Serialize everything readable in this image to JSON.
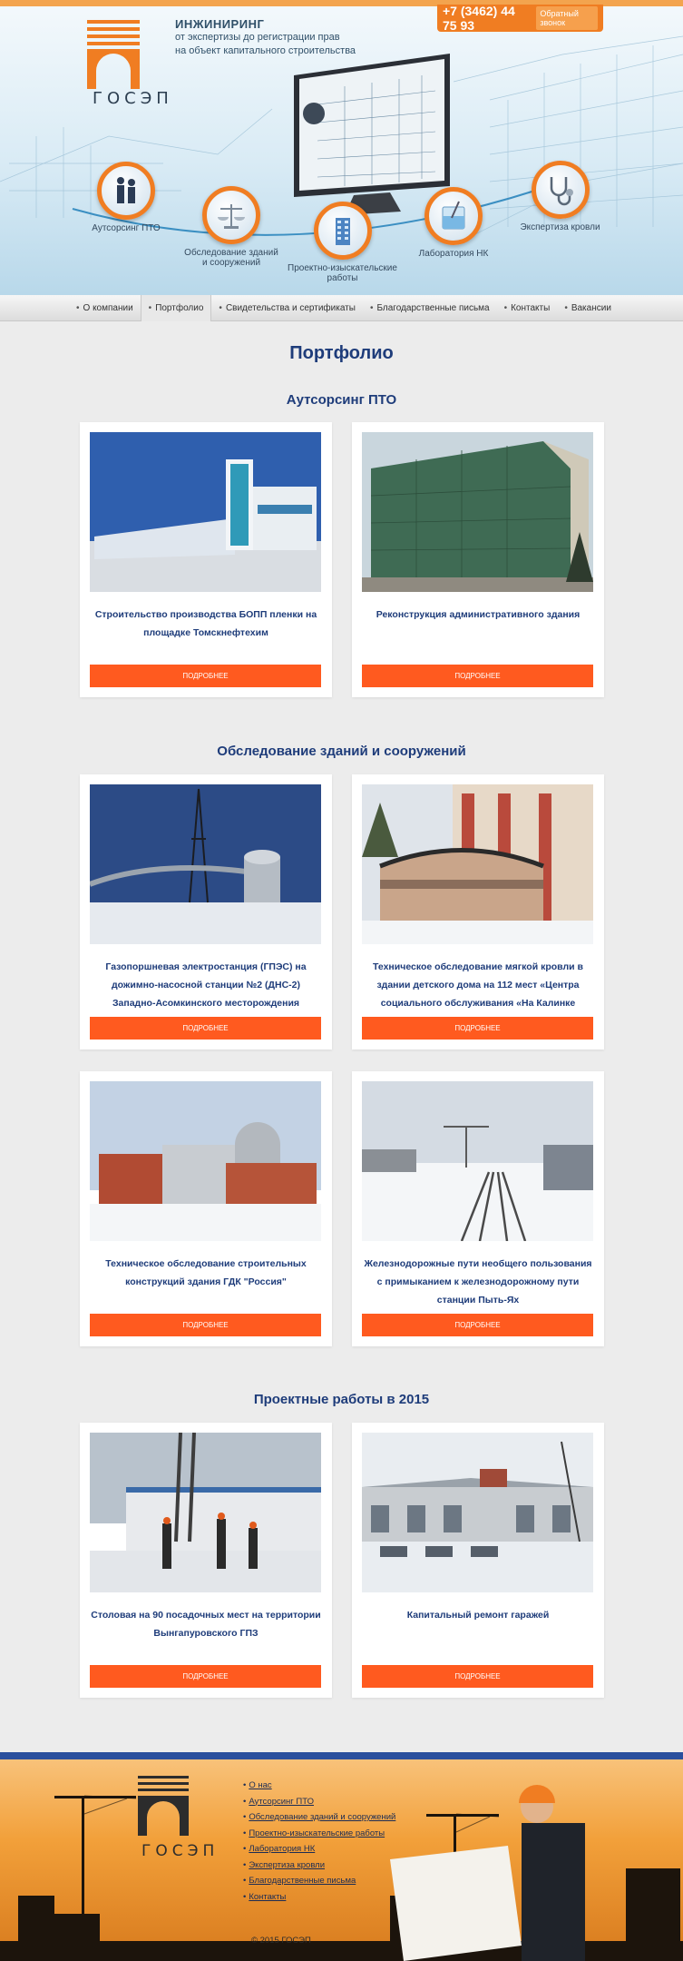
{
  "header": {
    "logo_text": "ГОСЭП",
    "tagline_title": "ИНЖИНИРИНГ",
    "tagline_line1": "от экспертизы до регистрации прав",
    "tagline_line2": "на объект капитального строительства",
    "phone": "+7 (3462) 44 75 93",
    "callback_label": "Обратный звонок",
    "services": [
      {
        "label": "Аутсорсинг ПТО",
        "icon": "people-icon"
      },
      {
        "label": "Обследование зданий и сооружений",
        "icon": "scales-icon"
      },
      {
        "label": "Проектно-изыскательские работы",
        "icon": "building-icon"
      },
      {
        "label": "Лаборатория НК",
        "icon": "flask-icon"
      },
      {
        "label": "Экспертиза кровли",
        "icon": "stethoscope-icon"
      }
    ]
  },
  "nav": {
    "items": [
      "О компании",
      "Портфолио",
      "Свидетельства и сертификаты",
      "Благодарственные письма",
      "Контакты",
      "Вакансии"
    ],
    "active": "Портфолио"
  },
  "main": {
    "title": "Портфолио",
    "sections": [
      {
        "title": "Аутсорсинг ПТО",
        "cards": [
          {
            "caption": "Строительство производства БОПП пленки на площадке Томскнефтехим",
            "button": "ПОДРОБНЕЕ"
          },
          {
            "caption": "Реконструкция административного здания",
            "button": "ПОДРОБНЕЕ"
          }
        ]
      },
      {
        "title": "Обследование зданий и сооружений",
        "cards": [
          {
            "caption": "Газопоршневая электростанция (ГПЭС) на дожимно-насосной станции №2 (ДНС-2) Западно-Асомкинского месторождения",
            "button": "ПОДРОБНЕЕ"
          },
          {
            "caption": "Техническое обследование мягкой кровли в здании детского дома на 112 мест «Центра социального обслуживания «На Калинке",
            "button": "ПОДРОБНЕЕ"
          },
          {
            "caption": "Техническое обследование строительных конструкций здания ГДК \"Россия\"",
            "button": "ПОДРОБНЕЕ"
          },
          {
            "caption": "Железнодорожные пути необщего пользования с примыканием к железнодорожному пути станции Пыть-Ях",
            "button": "ПОДРОБНЕЕ"
          }
        ]
      },
      {
        "title": "Проектные работы в 2015",
        "cards": [
          {
            "caption": "Столовая на 90 посадочных мест на территории Вынгапуровского ГПЗ",
            "button": "ПОДРОБНЕЕ"
          },
          {
            "caption": "Капитальный ремонт гаражей",
            "button": "ПОДРОБНЕЕ"
          }
        ]
      }
    ]
  },
  "footer": {
    "logo_text": "ГОСЭП",
    "menu": [
      "О нас",
      "Аутсорсинг ПТО",
      "Обследование зданий и сооружений",
      "Проектно-изыскательские работы",
      "Лаборатория НК",
      "Экспертиза кровли",
      "Благодарственные письма",
      "Контакты"
    ],
    "copyright": "© 2015 ГОСЭП"
  },
  "colors": {
    "accent": "#ff5a1f",
    "orange": "#f07d22",
    "heading": "#1e3c7a",
    "footer_stripe": "#2a4f9d"
  }
}
